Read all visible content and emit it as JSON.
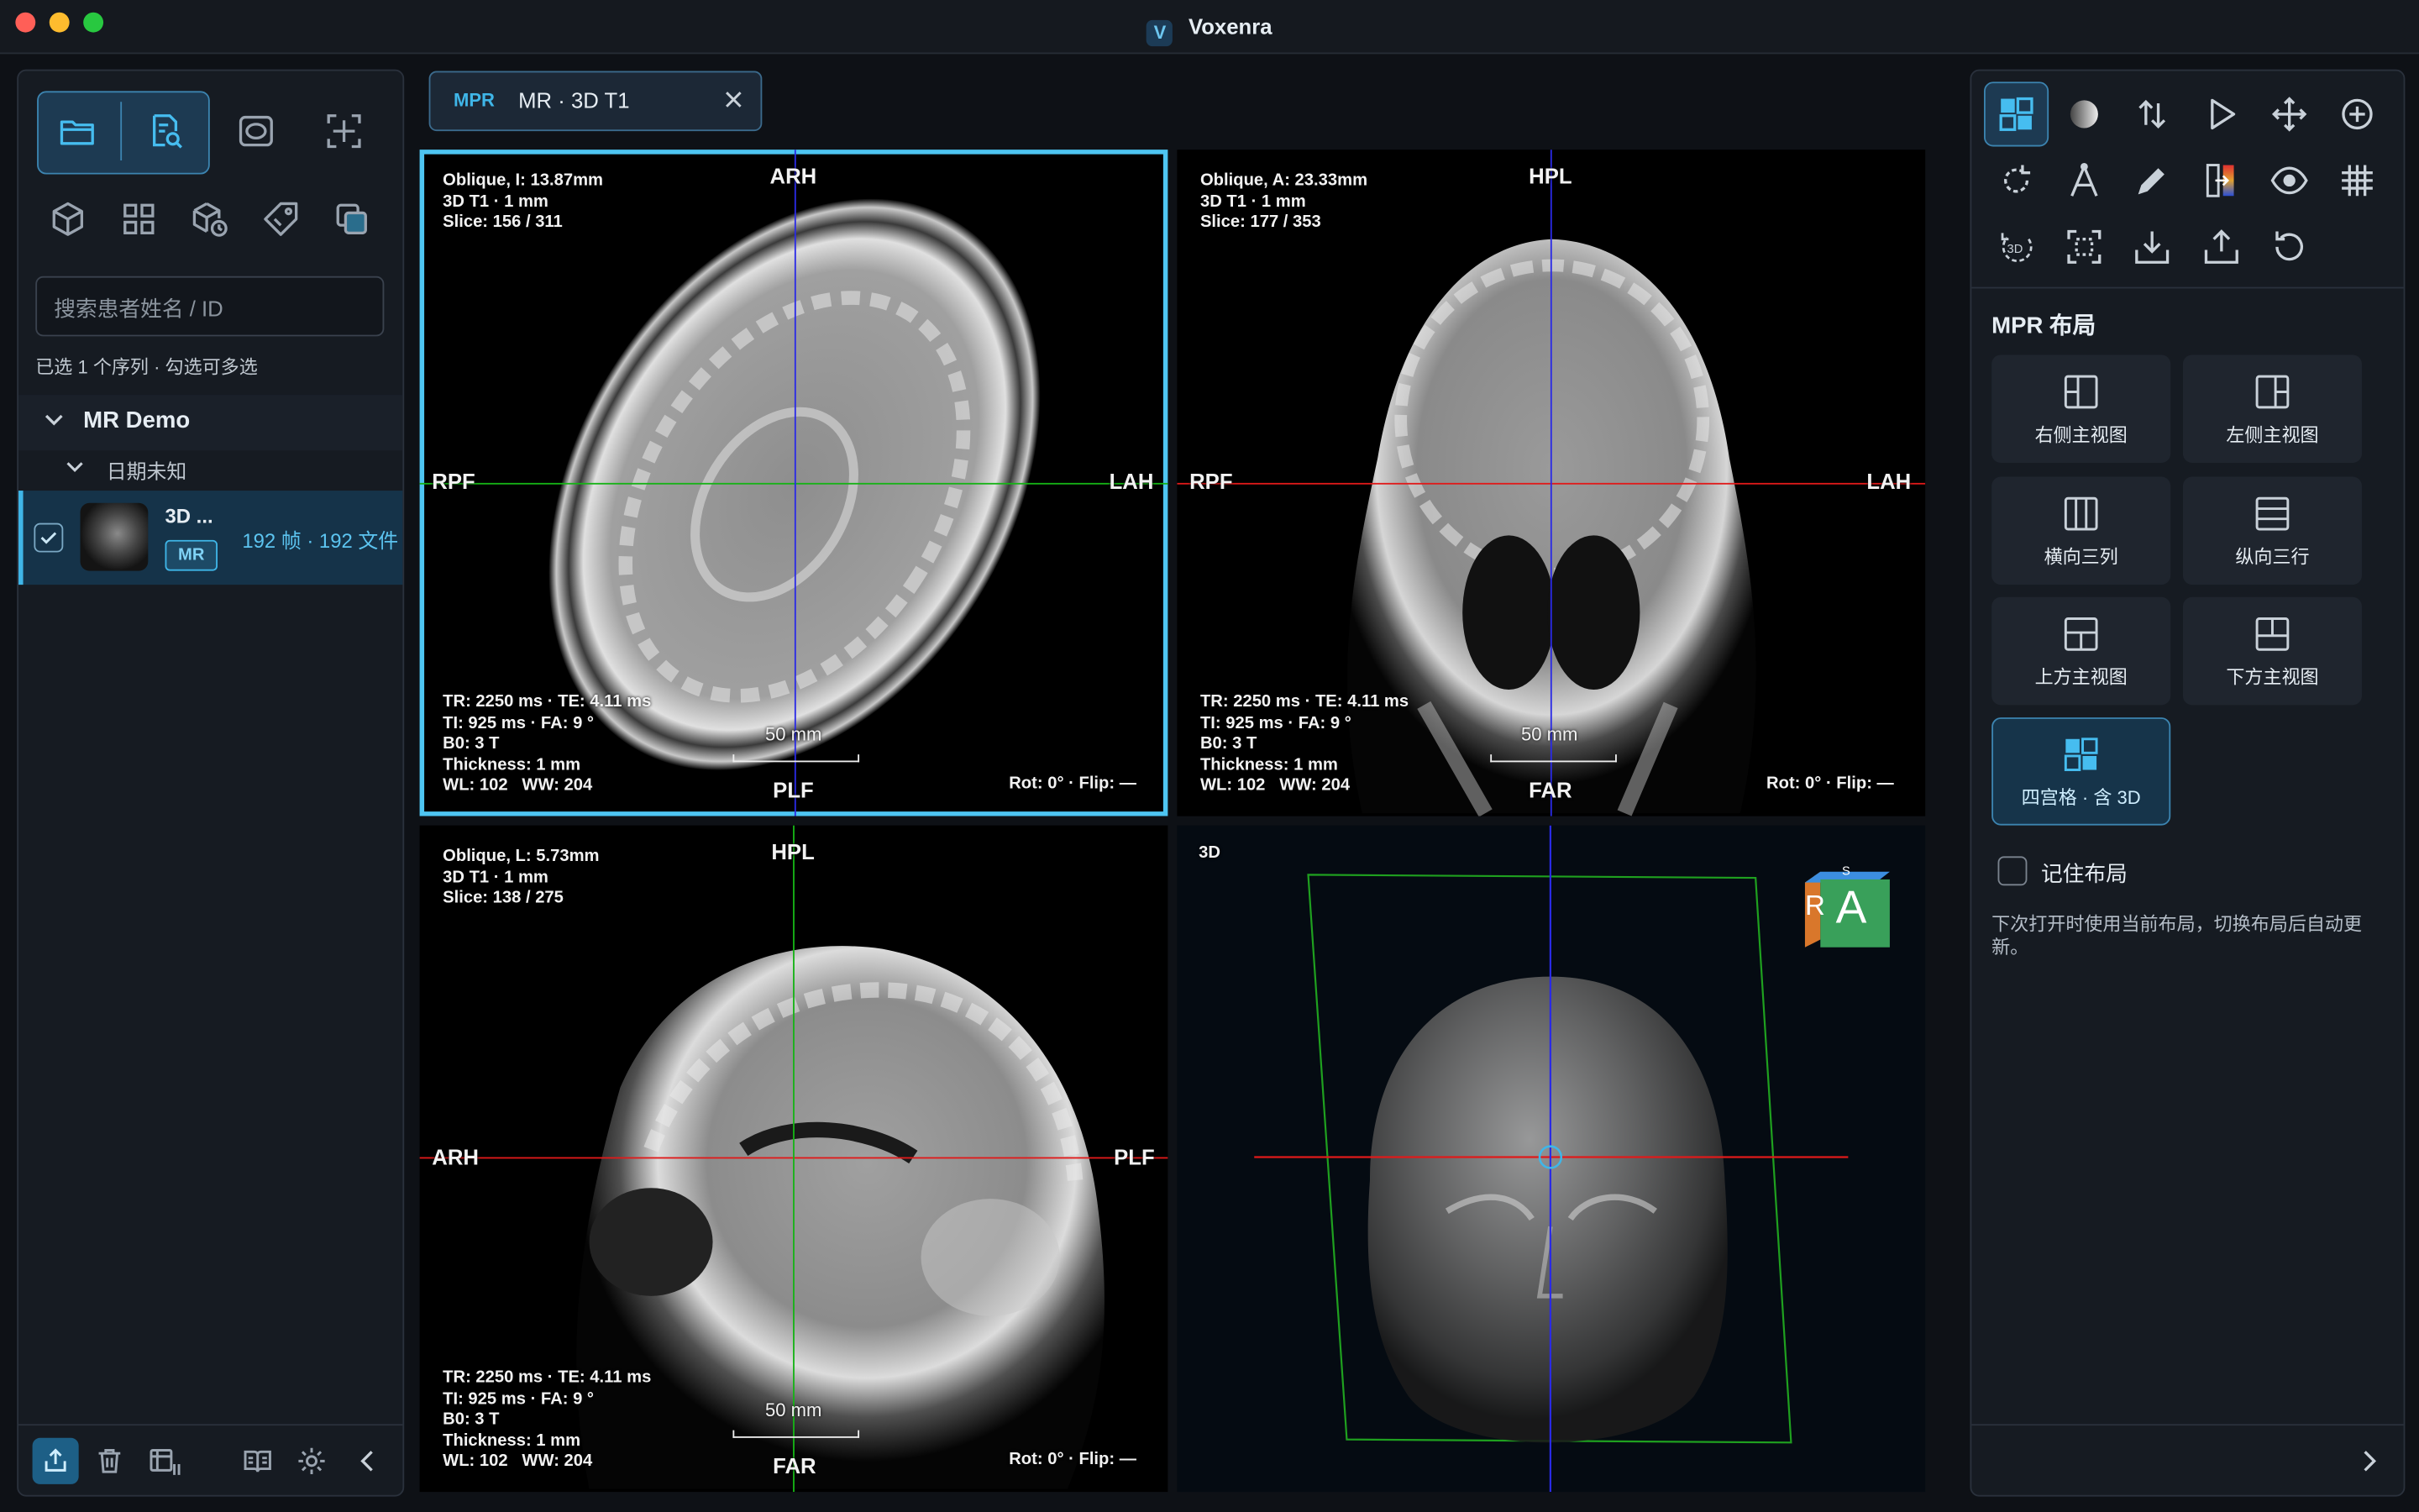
{
  "app": {
    "title": "Voxenra",
    "logo": "V"
  },
  "left_panel": {
    "search_placeholder": "搜索患者姓名 / ID",
    "selection_hint": "已选 1 个序列 · 勾选可多选",
    "tree": {
      "group": "MR Demo",
      "date": "日期未知",
      "series": {
        "name": "3D ...",
        "modality": "MR",
        "counts": "192 帧 · 192 文件",
        "checked": true
      }
    }
  },
  "tabs": [
    {
      "badge": "MPR",
      "title": "MR · 3D T1"
    }
  ],
  "viewports": {
    "axial": {
      "info": "Oblique, I: 13.87mm\n3D T1 · 1 mm\nSlice: 156 / 311",
      "params": "TR: 2250 ms · TE: 4.11 ms\nTI: 925 ms · FA: 9 °\nB0: 3 T\nThickness: 1 mm\nWL: 102   WW: 204",
      "top": "ARH",
      "bottom": "PLF",
      "left": "RPF",
      "right": "LAH",
      "scale": "50 mm",
      "rot": "Rot: 0° · Flip: —"
    },
    "coronal": {
      "info": "Oblique, A: 23.33mm\n3D T1 · 1 mm\nSlice: 177 / 353",
      "params": "TR: 2250 ms · TE: 4.11 ms\nTI: 925 ms · FA: 9 °\nB0: 3 T\nThickness: 1 mm\nWL: 102   WW: 204",
      "top": "HPL",
      "bottom": "FAR",
      "left": "RPF",
      "right": "LAH",
      "scale": "50 mm",
      "rot": "Rot: 0° · Flip: —"
    },
    "sagittal": {
      "info": "Oblique, L: 5.73mm\n3D T1 · 1 mm\nSlice: 138 / 275",
      "params": "TR: 2250 ms · TE: 4.11 ms\nTI: 925 ms · FA: 9 °\nB0: 3 T\nThickness: 1 mm\nWL: 102   WW: 204",
      "top": "HPL",
      "bottom": "FAR",
      "left": "ARH",
      "right": "PLF",
      "scale": "50 mm",
      "rot": "Rot: 0° · Flip: —"
    },
    "volume": {
      "label": "3D",
      "cube_front": "A",
      "cube_side": "R",
      "cube_top": "S"
    }
  },
  "right_panel": {
    "section_title": "MPR 布局",
    "layouts": [
      "右侧主视图",
      "左侧主视图",
      "横向三列",
      "纵向三行",
      "上方主视图",
      "下方主视图",
      "四宫格 · 含 3D"
    ],
    "selected_layout": "四宫格 · 含 3D",
    "remember_label": "记住布局",
    "remember_checked": false,
    "remember_hint": "下次打开时使用当前布局，切换布局后自动更新。"
  },
  "colors": {
    "accent": "#3fb6e8",
    "background": "#0e1116",
    "panel": "#161b22",
    "axis_red": "#e01a1a",
    "axis_green": "#16b316",
    "axis_blue": "#2a2ae6"
  }
}
